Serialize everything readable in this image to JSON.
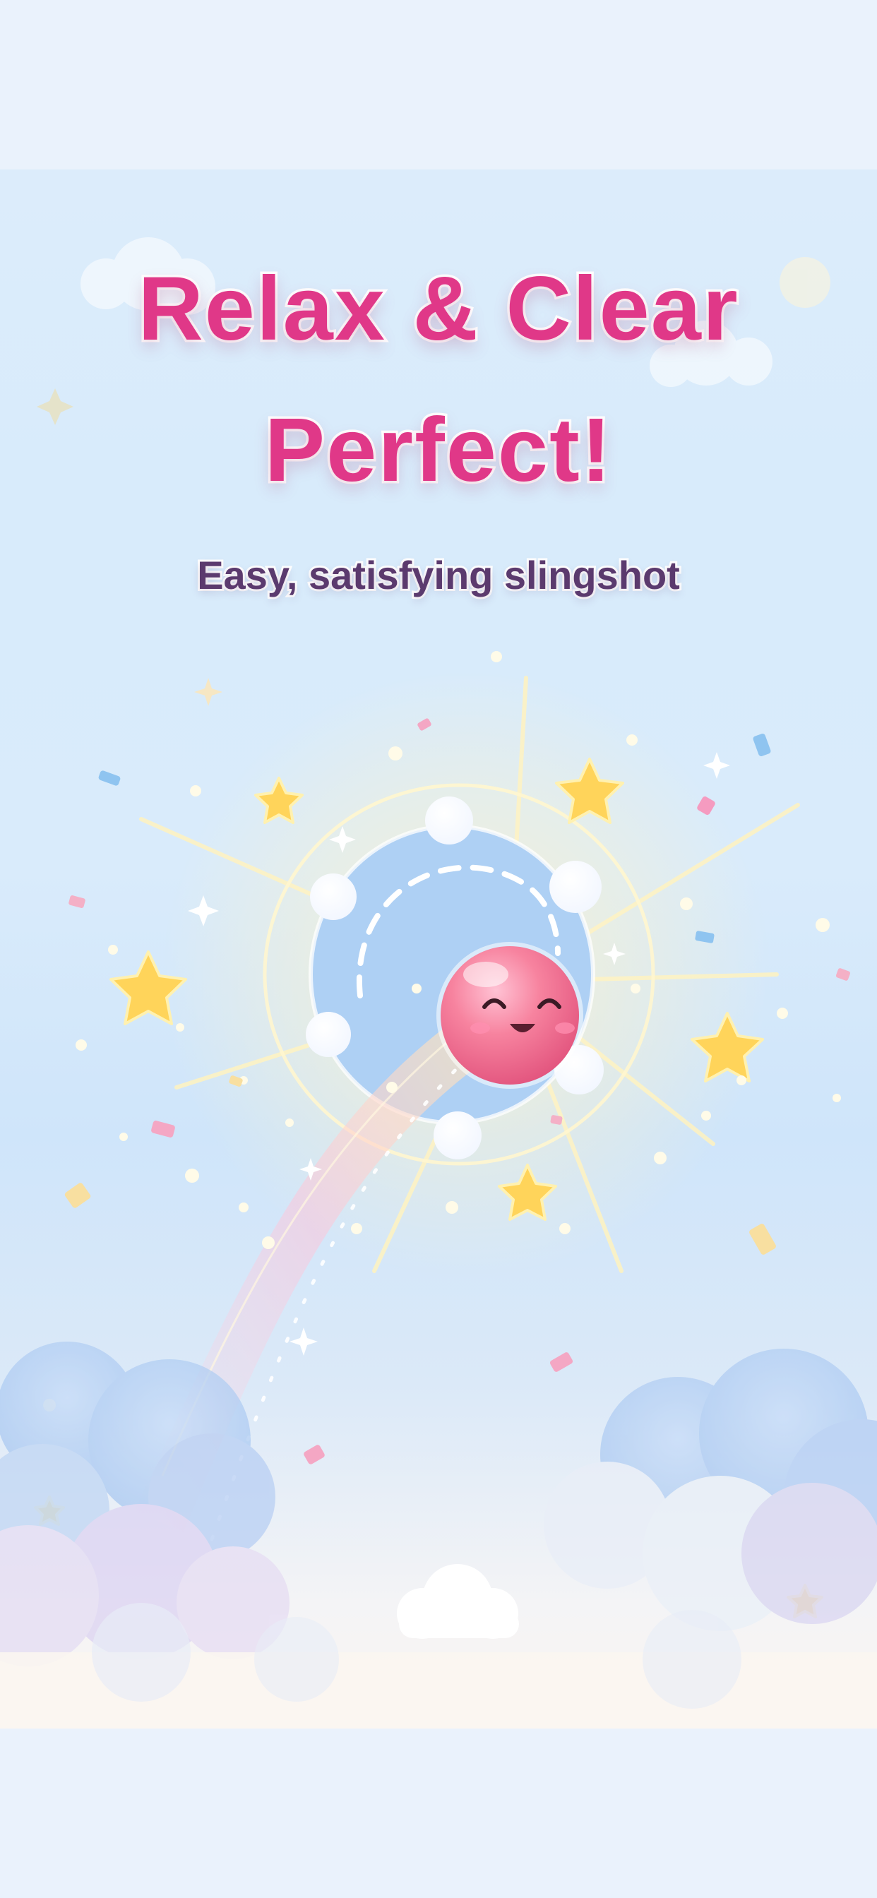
{
  "screen": {
    "headline_line1": "Relax & Clear",
    "headline_line2": "Perfect!",
    "subtitle": "Easy, satisfying slingshot"
  },
  "colors": {
    "headline": "#e03888",
    "subtitle": "#5b3a6e",
    "sky_top": "#dcecfb",
    "sky_bottom": "#faf5f0",
    "ball": "#f27ea3",
    "star": "#ffd45a"
  },
  "icons": {
    "hero": "pink-smiling-ball",
    "decoration": [
      "star",
      "sparkle",
      "confetti",
      "cloud",
      "bubble"
    ]
  }
}
